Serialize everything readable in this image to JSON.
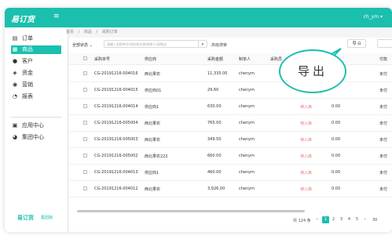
{
  "app": {
    "logo": "易订货",
    "user": "ch_ym ▾",
    "menu_icon": "menu-icon"
  },
  "sidebar": {
    "items": [
      {
        "label": "订单",
        "icon": "order-icon",
        "glyph": "▤"
      },
      {
        "label": "商品",
        "icon": "goods-icon",
        "glyph": "▦"
      },
      {
        "label": "客户",
        "icon": "customer-icon",
        "glyph": "●"
      },
      {
        "label": "资金",
        "icon": "funds-icon",
        "glyph": "◈"
      },
      {
        "label": "营销",
        "icon": "marketing-icon",
        "glyph": "◉"
      },
      {
        "label": "报表",
        "icon": "report-icon",
        "glyph": "◔"
      },
      {
        "label": "应用中心",
        "icon": "app-center-icon",
        "glyph": "▣"
      },
      {
        "label": "集团中心",
        "icon": "group-center-icon",
        "glyph": "◕"
      }
    ],
    "brand": "易订货",
    "brand_sub": "集团版"
  },
  "breadcrumb": [
    "首页",
    "/",
    "商品",
    "/",
    "采购订单"
  ],
  "toolbar": {
    "status_filter": "全部状态 ⌄",
    "search_placeholder": "请输入采购单号/供应商名称/制单人/采购员",
    "advanced_search": "高级搜索",
    "export_label": "导 ⊟"
  },
  "table": {
    "headers": [
      "采购单号",
      "供应商",
      "采购金额",
      "制单人",
      "采购员",
      "",
      "付款"
    ],
    "rows": [
      [
        "CG-20191216-004016",
        "西北果农",
        "11,335.00",
        "chenym",
        "",
        "",
        "未付"
      ],
      [
        "CG-20191216-004015",
        "供应商01",
        "29.60",
        "chenym",
        "",
        "",
        "未付"
      ],
      [
        "CG-20191216-004014",
        "供应商1",
        "630.00",
        "chenym",
        "待入库",
        "0.00",
        "未付"
      ],
      [
        "CG-20191216-005004",
        "西北果农",
        "765.00",
        "chenym",
        "待入库",
        "0.00",
        "未付"
      ],
      [
        "CG-20191216-005003",
        "西北果农",
        "349.50",
        "chenym",
        "待入库",
        "0.00",
        "未付"
      ],
      [
        "CG-20191216-005002",
        "西北果农222",
        "660.00",
        "chenym",
        "待入库",
        "0.00",
        "未付"
      ],
      [
        "CG-20191216-004013",
        "供应商1",
        "460.00",
        "chenym",
        "待入库",
        "0.00",
        "未付"
      ],
      [
        "CG-20191216-004012",
        "西北果农",
        "3,926.00",
        "chenym",
        "待入库",
        "0.00",
        "未付"
      ]
    ]
  },
  "pager": {
    "total": "共 124 条",
    "prev": "‹",
    "pages": [
      "1",
      "2",
      "3",
      "4",
      "5"
    ],
    "next": "›",
    "page_size": "30"
  },
  "callout": {
    "text": "导出"
  },
  "colors": {
    "accent": "#1bbfae",
    "pending": "#f56c6c"
  }
}
